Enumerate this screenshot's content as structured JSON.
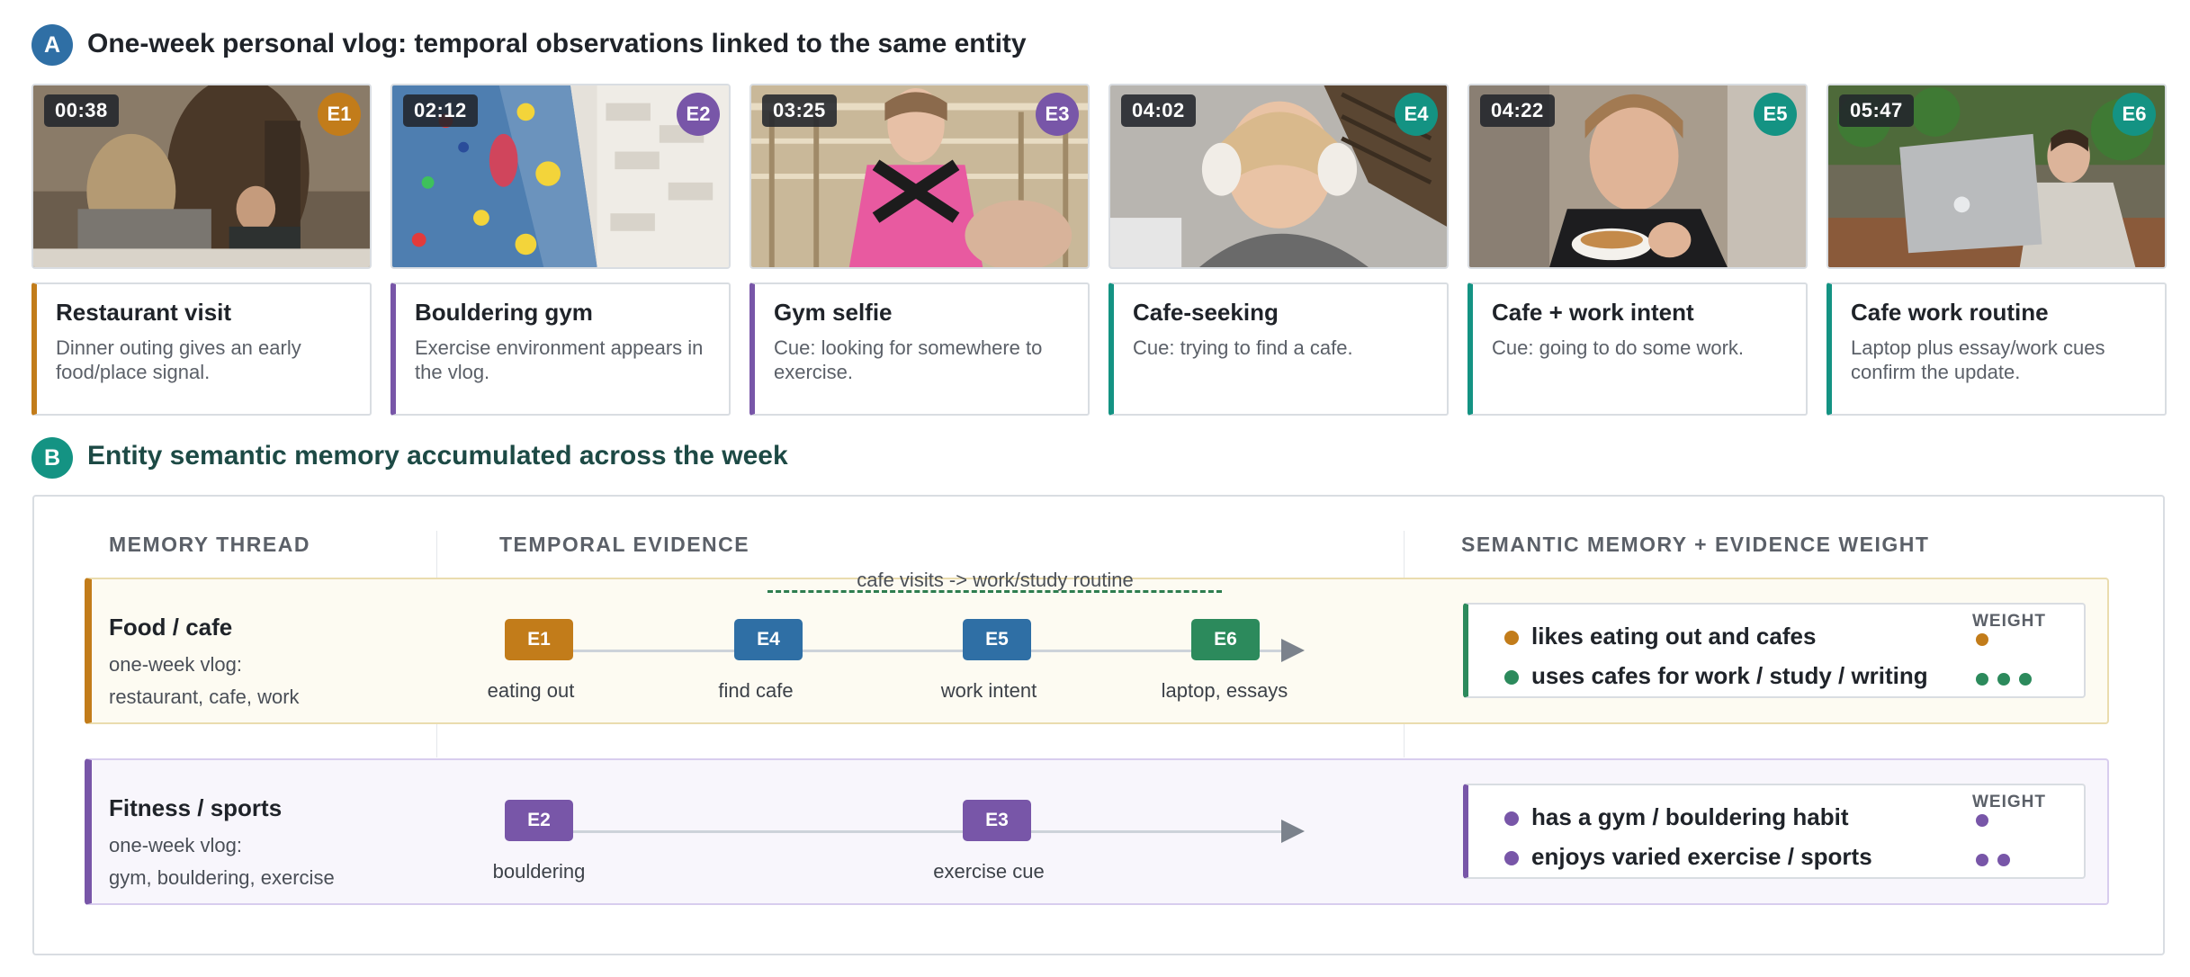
{
  "section_a": {
    "badge": "A",
    "title": "One-week personal vlog: temporal observations linked to the same entity"
  },
  "frames": [
    {
      "time": "00:38",
      "entity": "E1",
      "title": "Restaurant visit",
      "desc": "Dinner outing gives an early food/place signal.",
      "color": "#c27c1a",
      "card_color": "#c27c1a"
    },
    {
      "time": "02:12",
      "entity": "E2",
      "title": "Bouldering gym",
      "desc": "Exercise environment appears in the vlog.",
      "color": "#7856a8",
      "card_color": "#7856a8"
    },
    {
      "time": "03:25",
      "entity": "E3",
      "title": "Gym selfie",
      "desc": "Cue: looking for somewhere to exercise.",
      "color": "#7856a8",
      "card_color": "#7856a8"
    },
    {
      "time": "04:02",
      "entity": "E4",
      "title": "Cafe-seeking",
      "desc": "Cue: trying to find a cafe.",
      "color": "#149383",
      "card_color": "#149383"
    },
    {
      "time": "04:22",
      "entity": "E5",
      "title": "Cafe + work intent",
      "desc": "Cue: going to do some work.",
      "color": "#149383",
      "card_color": "#149383"
    },
    {
      "time": "05:47",
      "entity": "E6",
      "title": "Cafe work routine",
      "desc": "Laptop plus essay/work cues confirm the update.",
      "color": "#149383",
      "card_color": "#149383"
    }
  ],
  "section_b": {
    "badge": "B",
    "title": "Entity semantic memory accumulated across the week"
  },
  "columns": {
    "memory_thread": "MEMORY THREAD",
    "temporal_evidence": "TEMPORAL EVIDENCE",
    "semantic_memory": "SEMANTIC MEMORY + EVIDENCE WEIGHT"
  },
  "threads": [
    {
      "title": "Food / cafe",
      "sub1": "one-week vlog:",
      "sub2": "restaurant, cafe, work",
      "bracket_label": "cafe visits -> work/study routine",
      "accent": "#c27c1a",
      "events": [
        {
          "id": "E1",
          "label": "eating out",
          "color": "#c27c1a"
        },
        {
          "id": "E4",
          "label": "find cafe",
          "color": "#2f6fa5"
        },
        {
          "id": "E5",
          "label": "work intent",
          "color": "#2f6fa5"
        },
        {
          "id": "E6",
          "label": "laptop, essays",
          "color": "#2c8a5c"
        }
      ],
      "weight_label": "WEIGHT",
      "memories": [
        {
          "text": "likes eating out and cafes",
          "color": "#c27c1a",
          "weight": 1
        },
        {
          "text": "uses cafes for work / study / writing",
          "color": "#2c8a5c",
          "weight": 3
        }
      ]
    },
    {
      "title": "Fitness / sports",
      "sub1": "one-week vlog:",
      "sub2": "gym, bouldering, exercise",
      "accent": "#7856a8",
      "events": [
        {
          "id": "E2",
          "label": "bouldering",
          "color": "#7856a8"
        },
        {
          "id": "E3",
          "label": "exercise cue",
          "color": "#7856a8"
        }
      ],
      "weight_label": "WEIGHT",
      "memories": [
        {
          "text": "has a gym / bouldering habit",
          "color": "#7856a8",
          "weight": 1
        },
        {
          "text": "enjoys varied exercise / sports",
          "color": "#7856a8",
          "weight": 2
        }
      ]
    }
  ]
}
